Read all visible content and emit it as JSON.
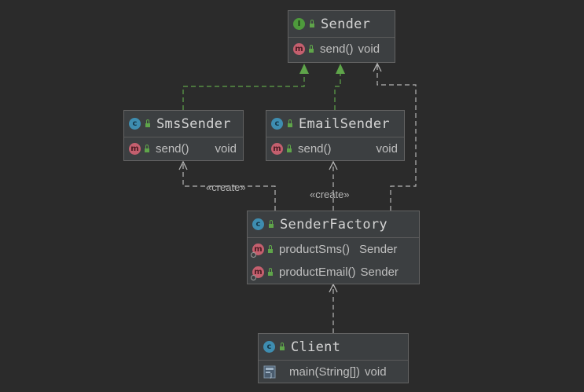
{
  "colors": {
    "background": "#2b2b2b",
    "box_fill": "#3c3f41",
    "box_border": "#636363",
    "realization_arrow": "#5fa54a",
    "dependency_arrow": "#b5b5b5",
    "interface_badge": "#4e9a3c",
    "class_badge": "#3e8db0",
    "method_badge": "#c45f6e"
  },
  "classes": {
    "sender": {
      "name": "Sender",
      "kind_badge": "I",
      "kind_icon": "interface-icon",
      "methods": [
        {
          "badge": "m",
          "name": "send()",
          "type": "void"
        }
      ]
    },
    "sms_sender": {
      "name": "SmsSender",
      "kind_badge": "c",
      "kind_icon": "class-icon",
      "methods": [
        {
          "badge": "m",
          "name": "send()",
          "type": "void"
        }
      ]
    },
    "email_sender": {
      "name": "EmailSender",
      "kind_badge": "c",
      "kind_icon": "class-icon",
      "methods": [
        {
          "badge": "m",
          "name": "send()",
          "type": "void"
        }
      ]
    },
    "sender_factory": {
      "name": "SenderFactory",
      "kind_badge": "c",
      "kind_icon": "class-icon",
      "methods": [
        {
          "badge": "m",
          "name": "productSms()",
          "type": "Sender"
        },
        {
          "badge": "m",
          "name": "productEmail()",
          "type": "Sender"
        }
      ]
    },
    "client": {
      "name": "Client",
      "kind_badge": "c",
      "kind_icon": "class-icon",
      "methods": [
        {
          "badge_icon": "java-main-icon",
          "name": "main(String[])",
          "type": "void"
        }
      ]
    }
  },
  "edges": {
    "create_label_sms": "«create»",
    "create_label_email": "«create»"
  }
}
